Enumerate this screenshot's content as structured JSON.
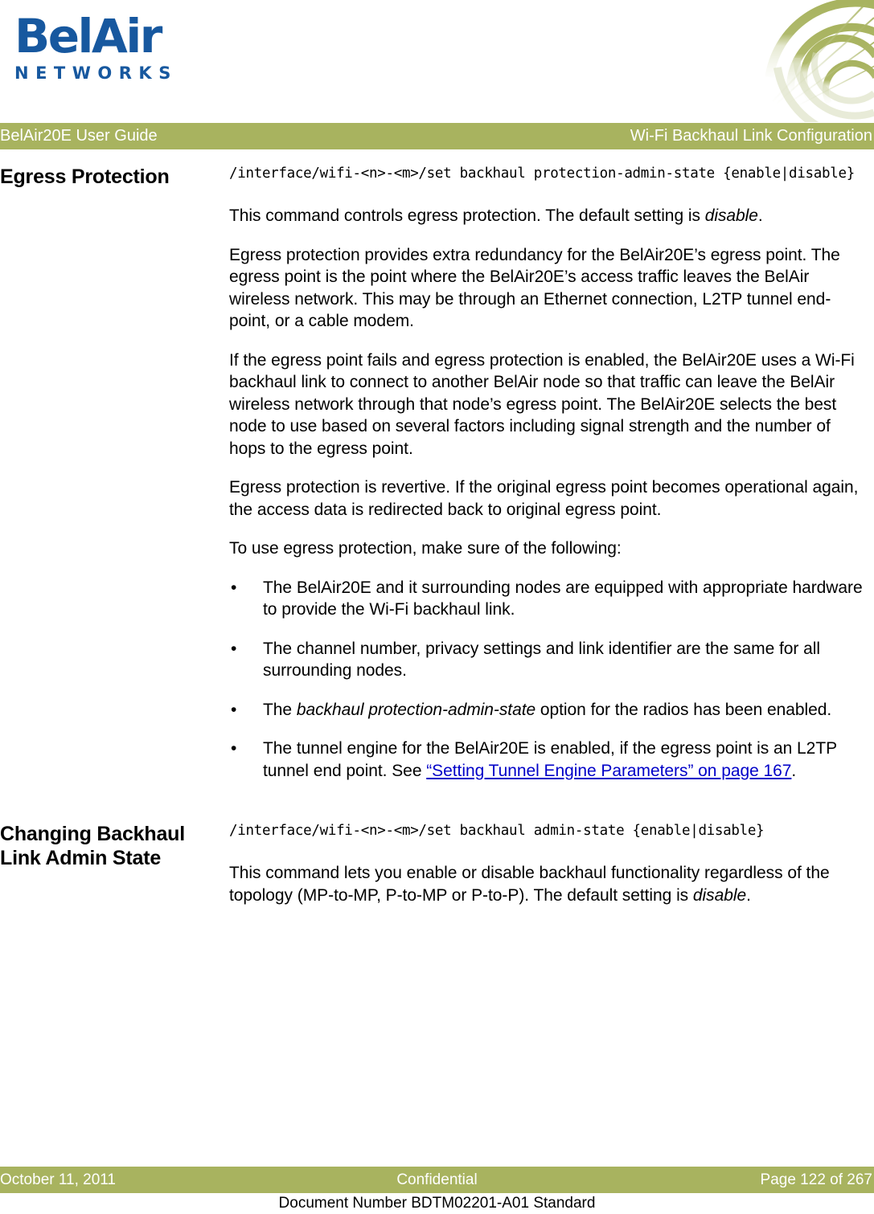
{
  "brand": {
    "logo_wordmark": "BelAir",
    "logo_subwordmark": "NETWORKS",
    "logo_color": "#17589F",
    "accent_color": "#A8B35F",
    "link_color": "#0000C8",
    "corner_graphic_name": "radial-signal-waves-graphic"
  },
  "header": {
    "left": "BelAir20E User Guide",
    "right": "Wi-Fi Backhaul Link Configuration"
  },
  "footer": {
    "left": "October 11, 2011",
    "center": "Confidential",
    "right": "Page 122 of 267",
    "subline": "Document Number BDTM02201-A01 Standard"
  },
  "sections": [
    {
      "heading": "Egress Protection",
      "command": "/interface/wifi-<n>-<m>/set backhaul protection-admin-state {enable|disable}",
      "paragraphs": [
        {
          "pre": "This command controls egress protection. The default setting is ",
          "italic": "disable",
          "post": "."
        },
        {
          "pre": "Egress protection provides extra redundancy for the BelAir20E’s egress point. The egress point is the point where the BelAir20E’s access traffic leaves the BelAir wireless network. This may be through an Ethernet connection, L2TP tunnel end-point, or a cable modem.",
          "italic": "",
          "post": ""
        },
        {
          "pre": "If the egress point fails and egress protection is enabled, the BelAir20E uses a Wi-Fi backhaul link to connect to another BelAir node so that traffic can leave the BelAir wireless network through that node’s egress point. The BelAir20E selects the best node to use based on several factors including signal strength and the number of hops to the egress point.",
          "italic": "",
          "post": ""
        },
        {
          "pre": "Egress protection is revertive. If the original egress point becomes operational again, the access data is redirected back to original egress point.",
          "italic": "",
          "post": ""
        },
        {
          "pre": "To use egress protection, make sure of the following:",
          "italic": "",
          "post": ""
        }
      ],
      "bullets": [
        {
          "marker": "•",
          "pre": "The BelAir20E and it surrounding nodes are equipped with appropriate hardware to provide the Wi-Fi backhaul link.",
          "italic": "",
          "post": "",
          "link": "",
          "tail": ""
        },
        {
          "marker": "•",
          "pre": "The channel number, privacy settings and link identifier are the same for all surrounding nodes.",
          "italic": "",
          "post": "",
          "link": "",
          "tail": ""
        },
        {
          "marker": "•",
          "pre": "The ",
          "italic": "backhaul protection-admin-state",
          "post": " option for the radios has been enabled.",
          "link": "",
          "tail": ""
        },
        {
          "marker": "•",
          "pre": "The tunnel engine for the BelAir20E is enabled, if the egress point is an L2TP tunnel end point. See ",
          "italic": "",
          "post": "",
          "link": "“Setting Tunnel Engine Parameters” on page 167",
          "tail": "."
        }
      ]
    },
    {
      "heading": "Changing Backhaul Link Admin State",
      "command": "/interface/wifi-<n>-<m>/set backhaul admin-state {enable|disable}",
      "paragraphs": [
        {
          "pre": "This command lets you enable or disable backhaul functionality regardless of the topology (MP-to-MP, P-to-MP or P-to-P). The default setting is ",
          "italic": "disable",
          "post": "."
        }
      ],
      "bullets": []
    }
  ]
}
